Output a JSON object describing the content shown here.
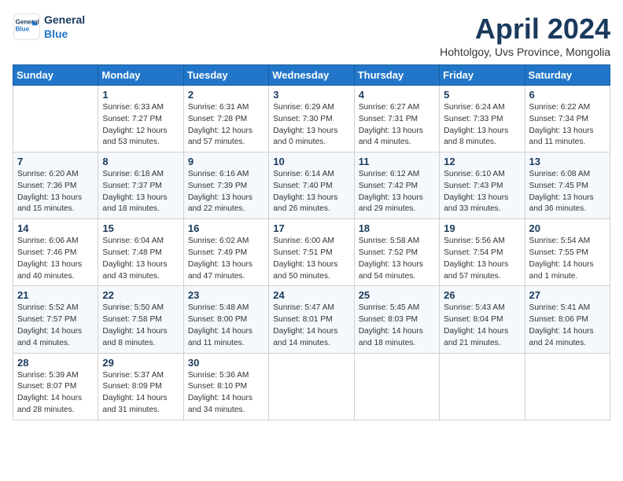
{
  "header": {
    "logo_line1": "General",
    "logo_line2": "Blue",
    "month": "April 2024",
    "location": "Hohtolgoy, Uvs Province, Mongolia"
  },
  "weekdays": [
    "Sunday",
    "Monday",
    "Tuesday",
    "Wednesday",
    "Thursday",
    "Friday",
    "Saturday"
  ],
  "weeks": [
    [
      {
        "day": "",
        "text": ""
      },
      {
        "day": "1",
        "text": "Sunrise: 6:33 AM\nSunset: 7:27 PM\nDaylight: 12 hours\nand 53 minutes."
      },
      {
        "day": "2",
        "text": "Sunrise: 6:31 AM\nSunset: 7:28 PM\nDaylight: 12 hours\nand 57 minutes."
      },
      {
        "day": "3",
        "text": "Sunrise: 6:29 AM\nSunset: 7:30 PM\nDaylight: 13 hours\nand 0 minutes."
      },
      {
        "day": "4",
        "text": "Sunrise: 6:27 AM\nSunset: 7:31 PM\nDaylight: 13 hours\nand 4 minutes."
      },
      {
        "day": "5",
        "text": "Sunrise: 6:24 AM\nSunset: 7:33 PM\nDaylight: 13 hours\nand 8 minutes."
      },
      {
        "day": "6",
        "text": "Sunrise: 6:22 AM\nSunset: 7:34 PM\nDaylight: 13 hours\nand 11 minutes."
      }
    ],
    [
      {
        "day": "7",
        "text": "Sunrise: 6:20 AM\nSunset: 7:36 PM\nDaylight: 13 hours\nand 15 minutes."
      },
      {
        "day": "8",
        "text": "Sunrise: 6:18 AM\nSunset: 7:37 PM\nDaylight: 13 hours\nand 18 minutes."
      },
      {
        "day": "9",
        "text": "Sunrise: 6:16 AM\nSunset: 7:39 PM\nDaylight: 13 hours\nand 22 minutes."
      },
      {
        "day": "10",
        "text": "Sunrise: 6:14 AM\nSunset: 7:40 PM\nDaylight: 13 hours\nand 26 minutes."
      },
      {
        "day": "11",
        "text": "Sunrise: 6:12 AM\nSunset: 7:42 PM\nDaylight: 13 hours\nand 29 minutes."
      },
      {
        "day": "12",
        "text": "Sunrise: 6:10 AM\nSunset: 7:43 PM\nDaylight: 13 hours\nand 33 minutes."
      },
      {
        "day": "13",
        "text": "Sunrise: 6:08 AM\nSunset: 7:45 PM\nDaylight: 13 hours\nand 36 minutes."
      }
    ],
    [
      {
        "day": "14",
        "text": "Sunrise: 6:06 AM\nSunset: 7:46 PM\nDaylight: 13 hours\nand 40 minutes."
      },
      {
        "day": "15",
        "text": "Sunrise: 6:04 AM\nSunset: 7:48 PM\nDaylight: 13 hours\nand 43 minutes."
      },
      {
        "day": "16",
        "text": "Sunrise: 6:02 AM\nSunset: 7:49 PM\nDaylight: 13 hours\nand 47 minutes."
      },
      {
        "day": "17",
        "text": "Sunrise: 6:00 AM\nSunset: 7:51 PM\nDaylight: 13 hours\nand 50 minutes."
      },
      {
        "day": "18",
        "text": "Sunrise: 5:58 AM\nSunset: 7:52 PM\nDaylight: 13 hours\nand 54 minutes."
      },
      {
        "day": "19",
        "text": "Sunrise: 5:56 AM\nSunset: 7:54 PM\nDaylight: 13 hours\nand 57 minutes."
      },
      {
        "day": "20",
        "text": "Sunrise: 5:54 AM\nSunset: 7:55 PM\nDaylight: 14 hours\nand 1 minute."
      }
    ],
    [
      {
        "day": "21",
        "text": "Sunrise: 5:52 AM\nSunset: 7:57 PM\nDaylight: 14 hours\nand 4 minutes."
      },
      {
        "day": "22",
        "text": "Sunrise: 5:50 AM\nSunset: 7:58 PM\nDaylight: 14 hours\nand 8 minutes."
      },
      {
        "day": "23",
        "text": "Sunrise: 5:48 AM\nSunset: 8:00 PM\nDaylight: 14 hours\nand 11 minutes."
      },
      {
        "day": "24",
        "text": "Sunrise: 5:47 AM\nSunset: 8:01 PM\nDaylight: 14 hours\nand 14 minutes."
      },
      {
        "day": "25",
        "text": "Sunrise: 5:45 AM\nSunset: 8:03 PM\nDaylight: 14 hours\nand 18 minutes."
      },
      {
        "day": "26",
        "text": "Sunrise: 5:43 AM\nSunset: 8:04 PM\nDaylight: 14 hours\nand 21 minutes."
      },
      {
        "day": "27",
        "text": "Sunrise: 5:41 AM\nSunset: 8:06 PM\nDaylight: 14 hours\nand 24 minutes."
      }
    ],
    [
      {
        "day": "28",
        "text": "Sunrise: 5:39 AM\nSunset: 8:07 PM\nDaylight: 14 hours\nand 28 minutes."
      },
      {
        "day": "29",
        "text": "Sunrise: 5:37 AM\nSunset: 8:09 PM\nDaylight: 14 hours\nand 31 minutes."
      },
      {
        "day": "30",
        "text": "Sunrise: 5:36 AM\nSunset: 8:10 PM\nDaylight: 14 hours\nand 34 minutes."
      },
      {
        "day": "",
        "text": ""
      },
      {
        "day": "",
        "text": ""
      },
      {
        "day": "",
        "text": ""
      },
      {
        "day": "",
        "text": ""
      }
    ]
  ]
}
